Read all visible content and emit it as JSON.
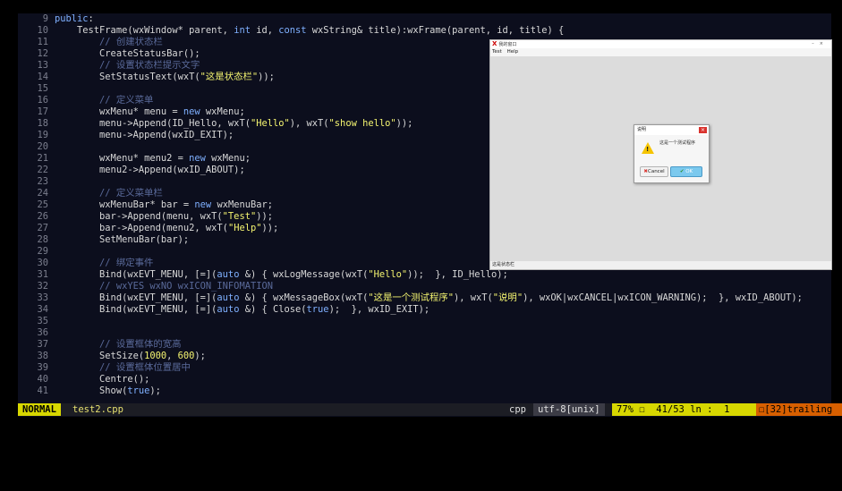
{
  "editor": {
    "lines": [
      {
        "n": "9",
        "parts": [
          [
            "kw",
            "public"
          ],
          [
            "",
            ":"
          ]
        ]
      },
      {
        "n": "10",
        "parts": [
          [
            "",
            "    TestFrame(wxWindow* parent, "
          ],
          [
            "kw",
            "int"
          ],
          [
            "",
            " id, "
          ],
          [
            "kw",
            "const"
          ],
          [
            "",
            " wxString& title):wxFrame(parent, id, title) {"
          ]
        ]
      },
      {
        "n": "11",
        "parts": [
          [
            "",
            "        "
          ],
          [
            "cm",
            "// 创建状态栏"
          ]
        ]
      },
      {
        "n": "12",
        "parts": [
          [
            "",
            "        CreateStatusBar();"
          ]
        ]
      },
      {
        "n": "13",
        "parts": [
          [
            "",
            "        "
          ],
          [
            "cm",
            "// 设置状态栏提示文字"
          ]
        ]
      },
      {
        "n": "14",
        "parts": [
          [
            "",
            "        SetStatusText(wxT("
          ],
          [
            "str",
            "\"这是状态栏\""
          ],
          [
            "",
            "));"
          ]
        ]
      },
      {
        "n": "15",
        "parts": []
      },
      {
        "n": "16",
        "parts": [
          [
            "",
            "        "
          ],
          [
            "cm",
            "// 定义菜单"
          ]
        ]
      },
      {
        "n": "17",
        "parts": [
          [
            "",
            "        wxMenu* menu = "
          ],
          [
            "kw",
            "new"
          ],
          [
            "",
            " wxMenu;"
          ]
        ]
      },
      {
        "n": "18",
        "parts": [
          [
            "",
            "        menu->Append(ID_Hello, wxT("
          ],
          [
            "str",
            "\"Hello\""
          ],
          [
            "",
            "), wxT("
          ],
          [
            "str",
            "\"show hello\""
          ],
          [
            "",
            "));"
          ]
        ]
      },
      {
        "n": "19",
        "parts": [
          [
            "",
            "        menu->Append(wxID_EXIT);"
          ]
        ]
      },
      {
        "n": "20",
        "parts": []
      },
      {
        "n": "21",
        "parts": [
          [
            "",
            "        wxMenu* menu2 = "
          ],
          [
            "kw",
            "new"
          ],
          [
            "",
            " wxMenu;"
          ]
        ]
      },
      {
        "n": "22",
        "parts": [
          [
            "",
            "        menu2->Append(wxID_ABOUT);"
          ]
        ]
      },
      {
        "n": "23",
        "parts": []
      },
      {
        "n": "24",
        "parts": [
          [
            "",
            "        "
          ],
          [
            "cm",
            "// 定义菜单栏"
          ]
        ]
      },
      {
        "n": "25",
        "parts": [
          [
            "",
            "        wxMenuBar* bar = "
          ],
          [
            "kw",
            "new"
          ],
          [
            "",
            " wxMenuBar;"
          ]
        ]
      },
      {
        "n": "26",
        "parts": [
          [
            "",
            "        bar->Append(menu, wxT("
          ],
          [
            "str",
            "\"Test\""
          ],
          [
            "",
            "));"
          ]
        ]
      },
      {
        "n": "27",
        "parts": [
          [
            "",
            "        bar->Append(menu2, wxT("
          ],
          [
            "str",
            "\"Help\""
          ],
          [
            "",
            "));"
          ]
        ]
      },
      {
        "n": "28",
        "parts": [
          [
            "",
            "        SetMenuBar(bar);"
          ]
        ]
      },
      {
        "n": "29",
        "parts": []
      },
      {
        "n": "30",
        "parts": [
          [
            "",
            "        "
          ],
          [
            "cm",
            "// 绑定事件"
          ]
        ]
      },
      {
        "n": "31",
        "parts": [
          [
            "",
            "        Bind(wxEVT_MENU, [=]("
          ],
          [
            "kw",
            "auto"
          ],
          [
            "",
            " &) { wxLogMessage(wxT("
          ],
          [
            "str",
            "\"Hello\""
          ],
          [
            "",
            "));  }, ID_Hello);"
          ]
        ]
      },
      {
        "n": "32",
        "parts": [
          [
            "",
            "        "
          ],
          [
            "cm",
            "// wxYES wxNO wxICON_INFOMATION"
          ]
        ]
      },
      {
        "n": "33",
        "parts": [
          [
            "",
            "        Bind(wxEVT_MENU, [=]("
          ],
          [
            "kw",
            "auto"
          ],
          [
            "",
            " &) { wxMessageBox(wxT("
          ],
          [
            "str",
            "\"这是一个测试程序\""
          ],
          [
            "",
            "), wxT("
          ],
          [
            "str",
            "\"说明\""
          ],
          [
            "",
            "), wxOK|wxCANCEL|wxICON_WARNING);  }, wxID_ABOUT);"
          ]
        ]
      },
      {
        "n": "34",
        "parts": [
          [
            "",
            "        Bind(wxEVT_MENU, [=]("
          ],
          [
            "kw",
            "auto"
          ],
          [
            "",
            " &) { Close("
          ],
          [
            "kw",
            "true"
          ],
          [
            "",
            ");  }, wxID_EXIT);"
          ]
        ]
      },
      {
        "n": "35",
        "parts": []
      },
      {
        "n": "36",
        "parts": []
      },
      {
        "n": "37",
        "parts": [
          [
            "",
            "        "
          ],
          [
            "cm",
            "// 设置框体的宽高"
          ]
        ]
      },
      {
        "n": "38",
        "parts": [
          [
            "",
            "        SetSize("
          ],
          [
            "str",
            "1000"
          ],
          [
            "",
            ", "
          ],
          [
            "str",
            "600"
          ],
          [
            "",
            ");"
          ]
        ]
      },
      {
        "n": "39",
        "parts": [
          [
            "",
            "        "
          ],
          [
            "cm",
            "// 设置框体位置居中"
          ]
        ]
      },
      {
        "n": "40",
        "parts": [
          [
            "",
            "        Centre();"
          ]
        ]
      },
      {
        "n": "41",
        "parts": [
          [
            "",
            "        Show("
          ],
          [
            "kw",
            "true"
          ],
          [
            "",
            ");"
          ]
        ]
      }
    ]
  },
  "statusline": {
    "mode": "NORMAL",
    "file": "test2.cpp",
    "filetype": "cpp",
    "encoding": "utf-8[unix]",
    "percent": "77% ☐",
    "position": "41/53 ln :  1",
    "trailing": "☐[32]trailing"
  },
  "appwindow": {
    "title": "我的窗口",
    "menus": [
      "Test",
      "Help"
    ],
    "statusbar": "这是状态栏"
  },
  "messagebox": {
    "title": "说明",
    "text": "这是一个测试程序",
    "cancel": "Cancel",
    "ok": "OK"
  }
}
